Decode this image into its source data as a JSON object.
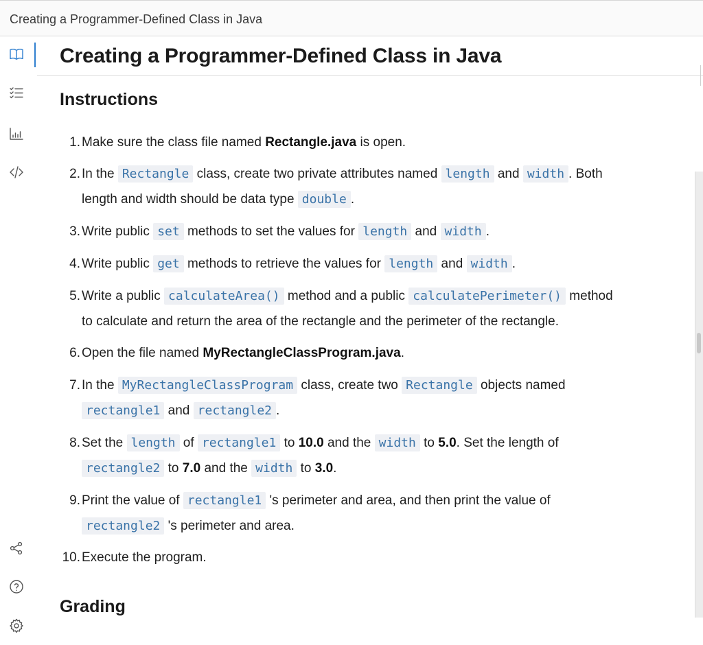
{
  "window": {
    "title": "Creating a Programmer-Defined Class in Java"
  },
  "header": {
    "title": "Creating a Programmer-Defined Class in Java"
  },
  "sidebar": {
    "icons": [
      "book-icon",
      "checklist-icon",
      "bar-chart-icon",
      "code-icon",
      "share-icon",
      "help-icon",
      "settings-icon"
    ]
  },
  "colors": {
    "accent": "#2f7fcf",
    "code_text": "#3a73a8",
    "code_bg": "#eef0f4"
  },
  "instructions": {
    "heading": "Instructions",
    "steps": [
      {
        "num": "1.",
        "a": "Make sure the class file named ",
        "b": "Rectangle.java",
        "c": " is open."
      },
      {
        "num": "2.",
        "a": "In the ",
        "code1": "Rectangle",
        "b": " class, create two private attributes named ",
        "code2": "length",
        "c": " and ",
        "code3": "width",
        "d": ". Both",
        "e": "length and width should be data type ",
        "code4": "double",
        "f": "."
      },
      {
        "num": "3.",
        "a": "Write public ",
        "code1": "set",
        "b": " methods to set the values for ",
        "code2": "length",
        "c": " and ",
        "code3": "width",
        "d": "."
      },
      {
        "num": "4.",
        "a": "Write public ",
        "code1": "get",
        "b": " methods to retrieve the values for ",
        "code2": "length",
        "c": " and ",
        "code3": "width",
        "d": "."
      },
      {
        "num": "5.",
        "a": "Write a public ",
        "code1": "calculateArea()",
        "b": " method and a public ",
        "code2": "calculatePerimeter()",
        "c": " method",
        "d": "to calculate and return the area of the rectangle and the perimeter of the rectangle."
      },
      {
        "num": "6.",
        "a": "Open the file named ",
        "b": "MyRectangleClassProgram.java",
        "c": "."
      },
      {
        "num": "7.",
        "a": "In the ",
        "code1": "MyRectangleClassProgram",
        "b": " class, create two ",
        "code2": "Rectangle",
        "c": " objects named",
        "code3": "rectangle1",
        "d": " and ",
        "code4": "rectangle2",
        "e": "."
      },
      {
        "num": "8.",
        "a": "Set the ",
        "code1": "length",
        "b": " of ",
        "code2": "rectangle1",
        "c": " to ",
        "v1": "10.0",
        "d": " and the ",
        "code3": "width",
        "e": " to ",
        "v2": "5.0",
        "f": ". Set the length of",
        "code4": "rectangle2",
        "g": " to ",
        "v3": "7.0",
        "h": " and the ",
        "code5": "width",
        "i": " to ",
        "v4": "3.0",
        "j": "."
      },
      {
        "num": "9.",
        "a": "Print the value of ",
        "code1": "rectangle1",
        "b": " 's perimeter and area, and then print the value of",
        "code2": "rectangle2",
        "c": " 's perimeter and area."
      },
      {
        "num": "10.",
        "a": "Execute the program."
      }
    ]
  },
  "grading": {
    "heading": "Grading"
  }
}
